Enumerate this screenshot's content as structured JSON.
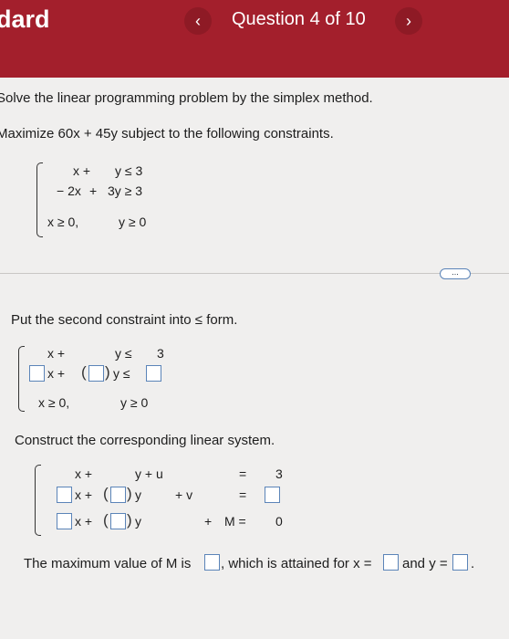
{
  "header": {
    "title": "dard",
    "question_label": "Question 4 of 10"
  },
  "icons": {
    "prev": "chevron-left-icon",
    "next": "chevron-right-icon",
    "more": "ellipsis-icon"
  },
  "colors": {
    "header_bg": "#a31f2c",
    "input_border": "#5b84b8"
  },
  "problem": {
    "instruction": "Solve the linear programming problem by the simplex method.",
    "objective": "Maximize 60x + 45y subject to the following constraints.",
    "c1": {
      "a": "x +",
      "b": "y ≤ 3"
    },
    "c2": {
      "a": "− 2x",
      "b": "+",
      "c": "3y ≥ 3"
    },
    "nonneg": {
      "x": "x ≥ 0,",
      "y": "y ≥ 0"
    }
  },
  "more_button": "...",
  "part1": {
    "prompt": "Put the second constraint into ≤ form.",
    "row1": {
      "a": "x +",
      "b": "y ≤",
      "c": "3"
    },
    "row2": {
      "a": "x +",
      "b": "y ≤"
    },
    "nonneg": {
      "x": "x ≥ 0,",
      "y": "y ≥ 0"
    }
  },
  "part2": {
    "prompt": "Construct the corresponding linear system.",
    "row1": {
      "a": "x +",
      "b": "y + u",
      "eq": "=",
      "rhs": "3"
    },
    "row2": {
      "a": "x +",
      "b": "y",
      "c": "+ v",
      "eq": "="
    },
    "row3": {
      "a": "x +",
      "b": "y",
      "c": "+",
      "d": "M =",
      "rhs": "0"
    }
  },
  "answer": {
    "a": "The maximum value of M is",
    "b": ", which is attained for x =",
    "c": "and y =",
    "d": "."
  }
}
